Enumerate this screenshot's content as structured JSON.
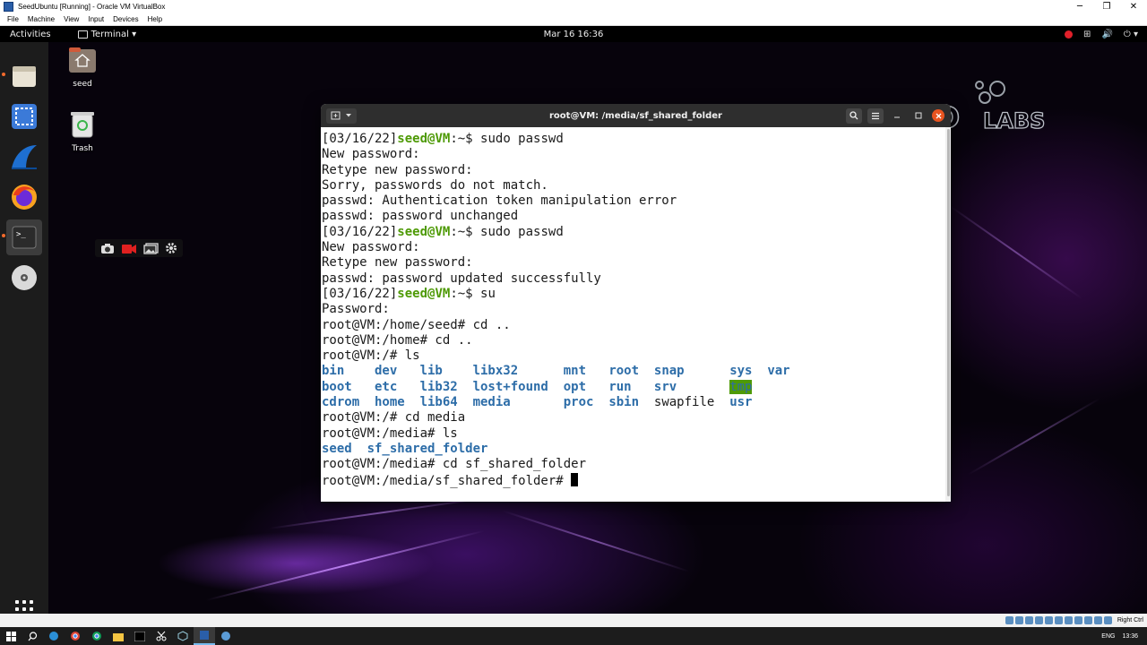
{
  "vbox": {
    "window_title": "SeedUbuntu [Running] - Oracle VM VirtualBox",
    "menu": [
      "File",
      "Machine",
      "View",
      "Input",
      "Devices",
      "Help"
    ],
    "controls": {
      "minimize": "─",
      "restore": "❐",
      "close": "✕"
    },
    "host_key": "Right Ctrl"
  },
  "topbar": {
    "activities": "Activities",
    "app_menu": "Terminal ▾",
    "clock": "Mar 16  16:36",
    "tray": [
      "⊞",
      "🔊",
      "⏻ ▾"
    ]
  },
  "desktop": {
    "icons": [
      {
        "label": "seed"
      },
      {
        "label": "Trash"
      }
    ],
    "logo_text": "SEED LABS"
  },
  "terminal": {
    "title": "root@VM: /media/sf_shared_folder",
    "lines": [
      {
        "prompt_date": "[03/16/22]",
        "prompt_user": "seed@VM",
        "prompt_rest": ":~$ sudo passwd"
      },
      {
        "text": "New password:"
      },
      {
        "text": "Retype new password:"
      },
      {
        "text": "Sorry, passwords do not match."
      },
      {
        "text": "passwd: Authentication token manipulation error"
      },
      {
        "text": "passwd: password unchanged"
      },
      {
        "prompt_date": "[03/16/22]",
        "prompt_user": "seed@VM",
        "prompt_rest": ":~$ sudo passwd"
      },
      {
        "text": "New password:"
      },
      {
        "text": "Retype new password:"
      },
      {
        "text": "passwd: password updated successfully"
      },
      {
        "prompt_date": "[03/16/22]",
        "prompt_user": "seed@VM",
        "prompt_rest": ":~$ su"
      },
      {
        "text": "Password:"
      },
      {
        "text": "root@VM:/home/seed# cd .."
      },
      {
        "text": "root@VM:/home# cd .."
      },
      {
        "text": "root@VM:/# ls"
      }
    ],
    "ls_root": [
      [
        "bin",
        "dev",
        "lib",
        "libx32",
        "mnt",
        "root",
        "snap",
        "sys",
        "var"
      ],
      [
        "boot",
        "etc",
        "lib32",
        "lost+found",
        "opt",
        "run",
        "srv",
        "tmp",
        ""
      ],
      [
        "cdrom",
        "home",
        "lib64",
        "media",
        "proc",
        "sbin",
        "swapfile",
        "usr",
        ""
      ]
    ],
    "after_ls": [
      "root@VM:/# cd media",
      "root@VM:/media# ls"
    ],
    "ls_media": [
      "seed",
      "sf_shared_folder"
    ],
    "after_ls2": [
      "root@VM:/media# cd sf_shared_folder"
    ],
    "current_prompt": "root@VM:/media/sf_shared_folder# "
  },
  "taskbar": {
    "lang": "ENG",
    "time": "13:36"
  }
}
